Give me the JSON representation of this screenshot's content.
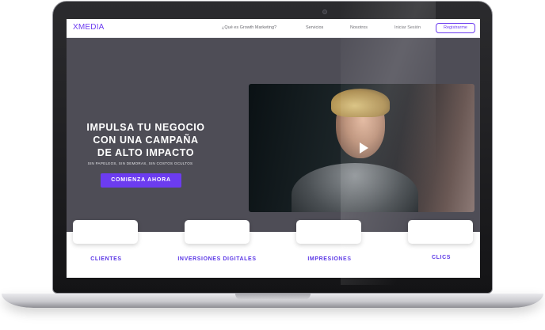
{
  "nav": {
    "logo": "XMEDIA",
    "links": [
      "¿Qué es Growth Marketing?",
      "Servicios",
      "Nosotros",
      "Iniciar Sesión"
    ],
    "register": "Registrarme"
  },
  "hero": {
    "title_lines": [
      "IMPULSA TU NEGOCIO",
      "CON UNA CAMPAÑA",
      "DE ALTO IMPACTO"
    ],
    "subtitle": "SIN PAPELEOS, SIN DEMORAS, SIN COSTOS OCULTOS",
    "cta": "COMIENZA AHORA"
  },
  "video": {
    "play_icon": "play-icon"
  },
  "stats": [
    {
      "label": "CLIENTES"
    },
    {
      "label": "INVERSIONES DIGITALES"
    },
    {
      "label": "IMPRESIONES"
    },
    {
      "label": "CLICS"
    }
  ],
  "colors": {
    "accent": "#6c3cf0",
    "hero_bg": "#4e4d56",
    "stat_text": "#5b37e6"
  }
}
